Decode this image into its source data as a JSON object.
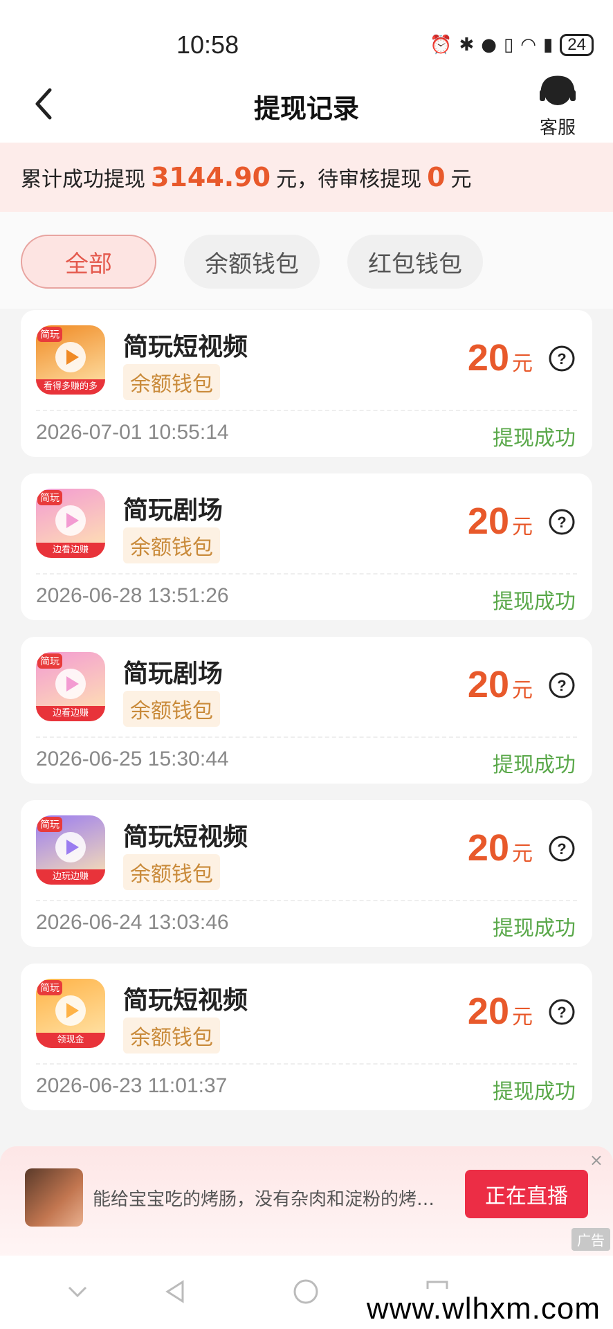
{
  "status_bar": {
    "time": "10:58",
    "battery": "24"
  },
  "nav": {
    "title": "提现记录",
    "service_label": "客服"
  },
  "summary": {
    "prefix": "累计成功提现",
    "total": "3144.90",
    "mid": "元，待审核提现",
    "pending": "0",
    "suffix": "元"
  },
  "tabs": [
    "全部",
    "余额钱包",
    "红包钱包"
  ],
  "records": [
    {
      "app": "简玩短视频",
      "wallet": "余额钱包",
      "amount": "20",
      "unit": "元",
      "time": "2026-07-01 10:55:14",
      "status": "提现成功",
      "icon_tag": "简玩",
      "icon_ribbon": "看得多赚的多",
      "icon_color": "#f08a24"
    },
    {
      "app": "简玩剧场",
      "wallet": "余额钱包",
      "amount": "20",
      "unit": "元",
      "time": "2026-06-28 13:51:26",
      "status": "提现成功",
      "icon_tag": "简玩",
      "icon_ribbon": "边看边赚",
      "icon_color": "#f39bd2"
    },
    {
      "app": "简玩剧场",
      "wallet": "余额钱包",
      "amount": "20",
      "unit": "元",
      "time": "2026-06-25 15:30:44",
      "status": "提现成功",
      "icon_tag": "简玩",
      "icon_ribbon": "边看边赚",
      "icon_color": "#f39bd2"
    },
    {
      "app": "简玩短视频",
      "wallet": "余额钱包",
      "amount": "20",
      "unit": "元",
      "time": "2026-06-24 13:03:46",
      "status": "提现成功",
      "icon_tag": "简玩",
      "icon_ribbon": "边玩边赚",
      "icon_color": "#9a7cf0"
    },
    {
      "app": "简玩短视频",
      "wallet": "余额钱包",
      "amount": "20",
      "unit": "元",
      "time": "2026-06-23 11:01:37",
      "status": "提现成功",
      "icon_tag": "简玩",
      "icon_ribbon": "领现金",
      "icon_color": "#ffb347"
    }
  ],
  "ad": {
    "text": "能给宝宝吃的烤肠，没有杂肉和淀粉的烤…",
    "button": "正在直播",
    "close": "×",
    "label": "广告"
  },
  "watermark": "www.wlhxm.com"
}
